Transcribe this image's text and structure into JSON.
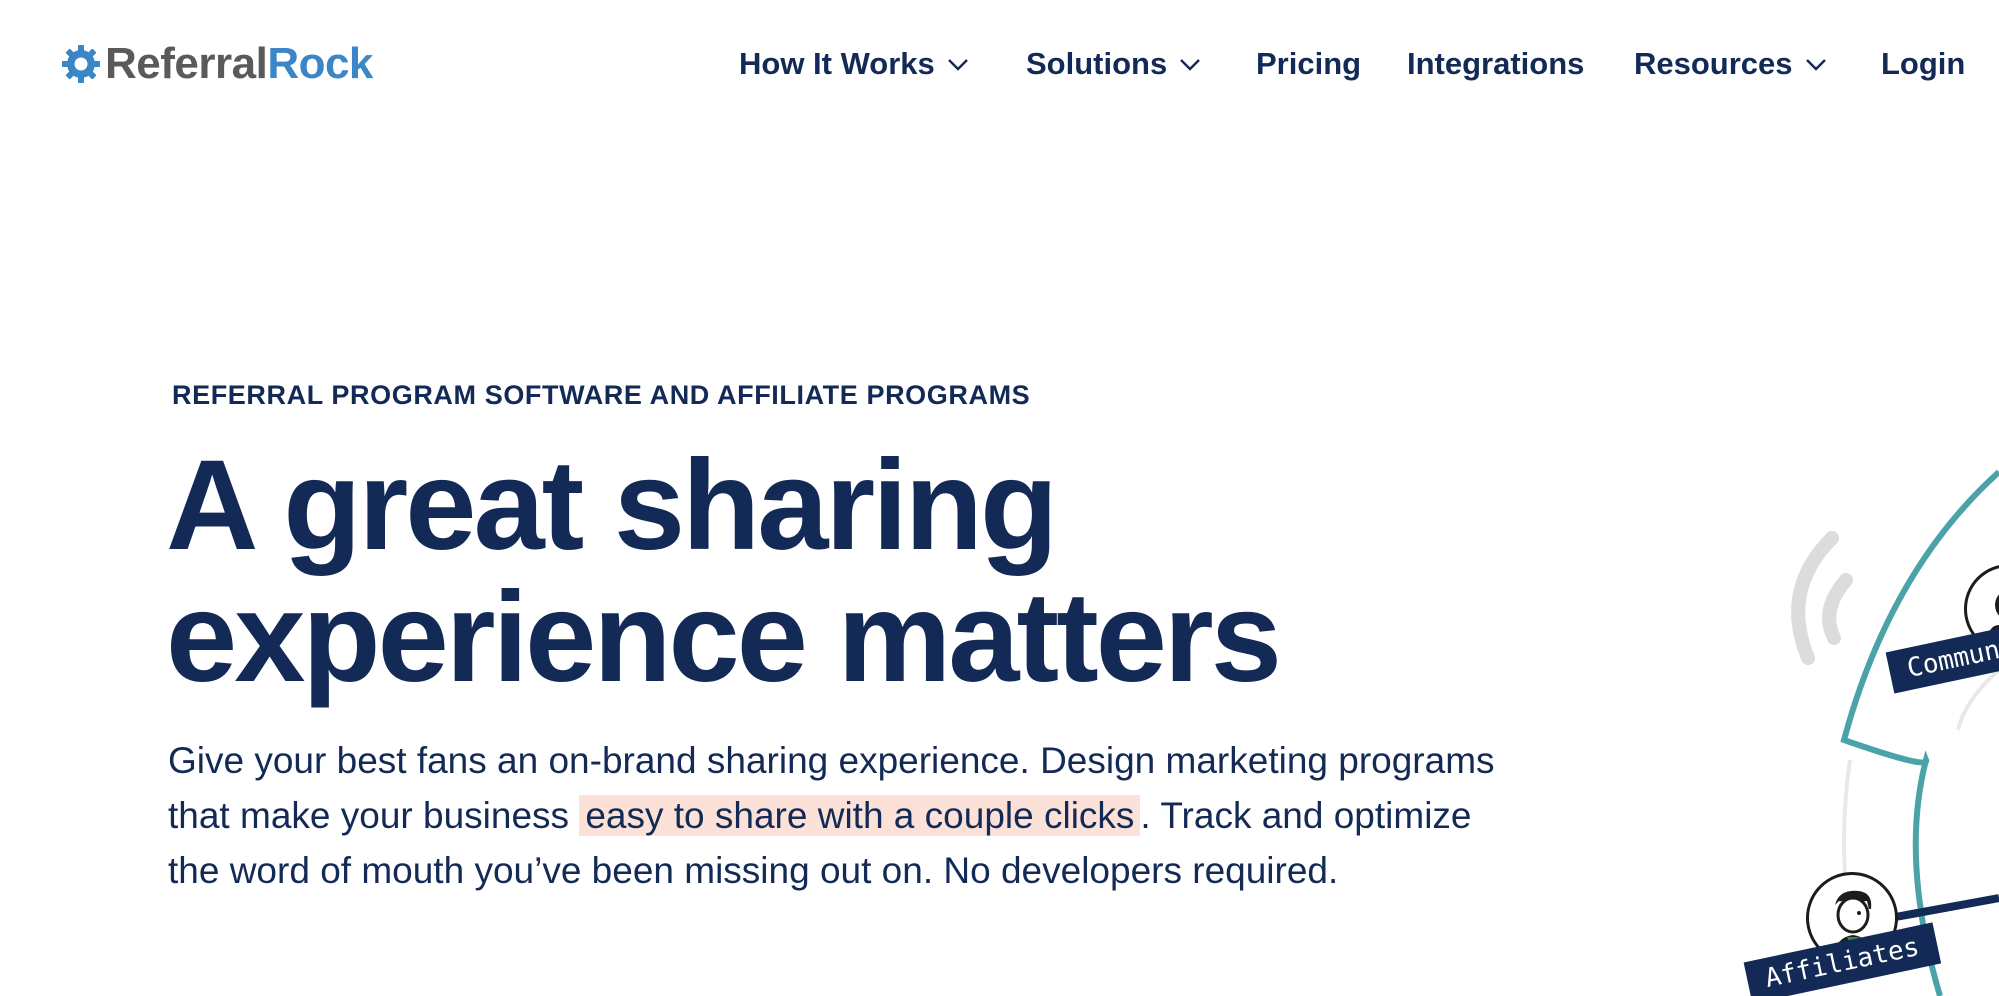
{
  "brand": {
    "name_part_1": "Referral",
    "name_part_2": "Rock",
    "color_gray": "#5a5a5a",
    "color_blue": "#3b86c6",
    "logo_icon": "gear-logo-icon"
  },
  "nav": {
    "items": [
      {
        "label": "How It Works",
        "has_dropdown": true
      },
      {
        "label": "Solutions",
        "has_dropdown": true
      },
      {
        "label": "Pricing",
        "has_dropdown": false
      },
      {
        "label": "Integrations",
        "has_dropdown": false
      },
      {
        "label": "Resources",
        "has_dropdown": true
      },
      {
        "label": "Login",
        "has_dropdown": false
      }
    ],
    "dropdown_icon": "chevron-down-icon"
  },
  "hero": {
    "eyebrow": "REFERRAL PROGRAM SOFTWARE AND AFFILIATE PROGRAMS",
    "headline_line_1": "A great sharing",
    "headline_line_2": "experience matters",
    "lead_part_1": "Give your best fans an on-brand sharing experience. Design marketing programs that make your business ",
    "lead_highlight": "easy to share with a couple clicks",
    "lead_part_2": ". Track and optimize the word of mouth you’ve been missing out on. No developers required.",
    "highlight_color": "#fbe1d8"
  },
  "illustration": {
    "tag_community": "Communi",
    "tag_affiliates": "Affiliates",
    "ring_color": "#4ba3a9",
    "tag_color": "#132a56",
    "signal_icon": "signal-waves-icon"
  },
  "colors": {
    "text_primary": "#132a56",
    "background": "#ffffff"
  }
}
